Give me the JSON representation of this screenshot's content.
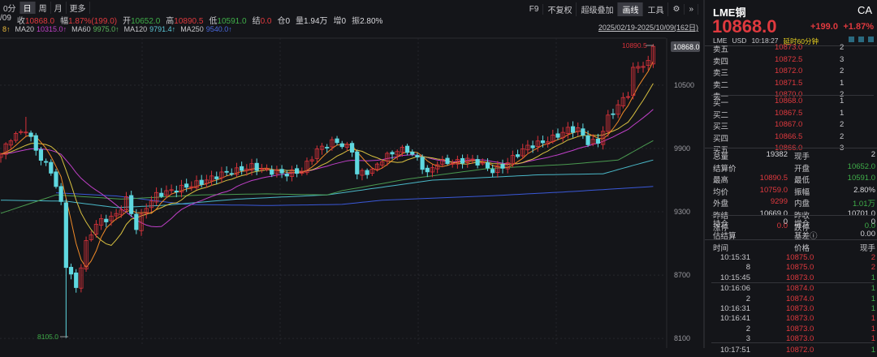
{
  "header": {
    "tabs": [
      "0分",
      "日",
      "周",
      "月",
      "更多"
    ],
    "active_tab": 1,
    "info": [
      {
        "label": "/09",
        "value": "",
        "cls": "wht"
      },
      {
        "label": "收",
        "value": "10868.0",
        "cls": "red"
      },
      {
        "label": "幅",
        "value": "1.87%(199.0)",
        "cls": "red"
      },
      {
        "label": "开",
        "value": "10652.0",
        "cls": "green"
      },
      {
        "label": "高",
        "value": "10890.5",
        "cls": "red"
      },
      {
        "label": "低",
        "value": "10591.0",
        "cls": "green"
      },
      {
        "label": "结",
        "value": "0.0",
        "cls": "red"
      },
      {
        "label": "仓",
        "value": "0",
        "cls": "wht"
      },
      {
        "label": "量",
        "value": "1.94万",
        "cls": "wht"
      },
      {
        "label": "增",
        "value": "0",
        "cls": "wht"
      },
      {
        "label": "振",
        "value": "2.80%",
        "cls": "wht"
      }
    ],
    "ma": [
      {
        "label": "",
        "value": "8↑",
        "color": "#e8b83c"
      },
      {
        "label": "MA20",
        "value": "10315.0↑",
        "color": "#c040c8"
      },
      {
        "label": "MA60",
        "value": "9975.0↑",
        "color": "#5cb85c"
      },
      {
        "label": "MA120",
        "value": "9791.4↑",
        "color": "#5bc8d8"
      },
      {
        "label": "MA250",
        "value": "9540.0↑",
        "color": "#4a6ae0"
      }
    ],
    "tools": [
      "F9",
      "不复权",
      "超级叠加",
      "画线",
      "工具",
      "⚙",
      "»"
    ],
    "active_tool": 3,
    "range": "2025/02/19-2025/10/09(162日)"
  },
  "chart_data": {
    "type": "candlestick",
    "price_axis": [
      10500,
      9900,
      9300,
      8700,
      8100
    ],
    "ylim": [
      8050,
      10950
    ],
    "high_label": "10890.5",
    "low_label": "8105.0",
    "last_label": "10868.0",
    "close_path": [
      [
        0,
        9846
      ],
      [
        2,
        10000
      ],
      [
        5,
        10080
      ],
      [
        8,
        9800
      ],
      [
        10,
        9690
      ],
      [
        12,
        9380
      ],
      [
        13,
        8800
      ],
      [
        14,
        8690
      ],
      [
        15,
        8580
      ],
      [
        17,
        9000
      ],
      [
        19,
        9190
      ],
      [
        21,
        9230
      ],
      [
        23,
        9270
      ],
      [
        25,
        9420
      ],
      [
        27,
        9150
      ],
      [
        29,
        9350
      ],
      [
        31,
        9460
      ],
      [
        34,
        9500
      ],
      [
        37,
        9540
      ],
      [
        40,
        9580
      ],
      [
        44,
        9660
      ],
      [
        47,
        9690
      ],
      [
        50,
        9730
      ],
      [
        53,
        9690
      ],
      [
        57,
        9660
      ],
      [
        60,
        9690
      ],
      [
        63,
        9885
      ],
      [
        66,
        9960
      ],
      [
        67,
        9960
      ],
      [
        70,
        9885
      ],
      [
        71,
        9660
      ],
      [
        74,
        9690
      ],
      [
        76,
        9800
      ],
      [
        79,
        9885
      ],
      [
        81,
        9885
      ],
      [
        83,
        9800
      ],
      [
        85,
        9660
      ],
      [
        87,
        9770
      ],
      [
        91,
        9770
      ],
      [
        93,
        9800
      ],
      [
        95,
        9770
      ],
      [
        98,
        9690
      ],
      [
        100,
        9730
      ],
      [
        103,
        9850
      ],
      [
        105,
        9920
      ],
      [
        108,
        9960
      ],
      [
        110,
        10000
      ],
      [
        113,
        10080
      ],
      [
        115,
        10080
      ],
      [
        117,
        9960
      ],
      [
        119,
        9960
      ],
      [
        121,
        10190
      ],
      [
        123,
        10310
      ],
      [
        125,
        10420
      ],
      [
        126,
        10650
      ],
      [
        128,
        10700
      ],
      [
        129,
        10708
      ],
      [
        130,
        10868
      ]
    ],
    "ma60": [
      [
        0,
        9286
      ],
      [
        11,
        9460
      ],
      [
        24,
        9420
      ],
      [
        40,
        9460
      ],
      [
        53,
        9470
      ],
      [
        65,
        9460
      ],
      [
        68,
        9500
      ],
      [
        81,
        9610
      ],
      [
        97,
        9710
      ],
      [
        113,
        9750
      ],
      [
        123,
        9790
      ],
      [
        130,
        9975
      ]
    ],
    "ma120": [
      [
        0,
        9410
      ],
      [
        13,
        9400
      ],
      [
        23,
        9340
      ],
      [
        32,
        9360
      ],
      [
        47,
        9420
      ],
      [
        65,
        9460
      ],
      [
        86,
        9600
      ],
      [
        107,
        9650
      ],
      [
        120,
        9660
      ],
      [
        126,
        9740
      ],
      [
        130,
        9791
      ]
    ],
    "ma250": [
      [
        11,
        9480
      ],
      [
        23,
        9450
      ],
      [
        37,
        9370
      ],
      [
        53,
        9360
      ],
      [
        68,
        9370
      ],
      [
        76,
        9410
      ],
      [
        97,
        9450
      ],
      [
        113,
        9490
      ],
      [
        130,
        9540
      ]
    ],
    "ma_colors": {
      "ma5": "#f08a28",
      "ma10": "#d8c040",
      "ma20": "#c040c8",
      "ma60": "#4a9a50",
      "ma120": "#4ab8c8",
      "ma250": "#3a58d8"
    }
  },
  "quote": {
    "name": "LME铜",
    "code": "CA",
    "price": "10868.0",
    "change": "+199.0",
    "pct": "+1.87%",
    "exchange": "LME",
    "currency": "USD",
    "time": "10:18:27",
    "delay": "延时60分钟",
    "asks": [
      [
        "卖五",
        "10873.0",
        "2"
      ],
      [
        "卖四",
        "10872.5",
        "3"
      ],
      [
        "卖三",
        "10872.0",
        "2"
      ],
      [
        "卖二",
        "10871.5",
        "1"
      ],
      [
        "卖一",
        "10870.0",
        "2"
      ]
    ],
    "bids": [
      [
        "买一",
        "10868.0",
        "1"
      ],
      [
        "买二",
        "10867.5",
        "1"
      ],
      [
        "买三",
        "10867.0",
        "2"
      ],
      [
        "买四",
        "10866.5",
        "2"
      ],
      [
        "买五",
        "10866.0",
        "3"
      ]
    ],
    "stats": [
      [
        "总量",
        "19382",
        "wht",
        "现手",
        "2",
        "wht"
      ],
      [
        "结算价",
        "",
        "wht",
        "开盘",
        "10652.0",
        "green"
      ],
      [
        "最高",
        "10890.5",
        "red",
        "最低",
        "10591.0",
        "green"
      ],
      [
        "均价",
        "10759.0",
        "red",
        "振幅",
        "2.80%",
        "wht"
      ],
      [
        "外盘",
        "9299",
        "red",
        "内盘",
        "1.01万",
        "green"
      ],
      [
        "昨结",
        "10669.0",
        "wht",
        "昨收",
        "10701.0",
        "wht"
      ],
      [
        "涨停",
        "0.0",
        "red",
        "跌停",
        "0.0",
        "green"
      ]
    ],
    "stats2": [
      [
        "持仓",
        "0",
        "wht",
        "增仓",
        "0",
        "wht"
      ],
      [
        "估结算",
        "",
        "wht",
        "基差ⓘ",
        "0.00",
        "wht"
      ]
    ],
    "trades_header": [
      "时间",
      "价格",
      "现手"
    ],
    "trades": [
      [
        "10:15:31",
        "10875.0",
        "2",
        "red"
      ],
      [
        "8",
        "10875.0",
        "2",
        "red"
      ],
      [
        "10:15:45",
        "10873.0",
        "1",
        "green"
      ],
      [
        "10:16:06",
        "10874.0",
        "1",
        "green"
      ],
      [
        "2",
        "10874.0",
        "1",
        "green"
      ],
      [
        "10:16:31",
        "10873.0",
        "1",
        "green"
      ],
      [
        "10:16:41",
        "10873.0",
        "1",
        "red"
      ],
      [
        "2",
        "10873.0",
        "1",
        "red"
      ],
      [
        "3",
        "10873.0",
        "1",
        "red"
      ],
      [
        "10:17:51",
        "10872.0",
        "1",
        "green"
      ]
    ]
  }
}
